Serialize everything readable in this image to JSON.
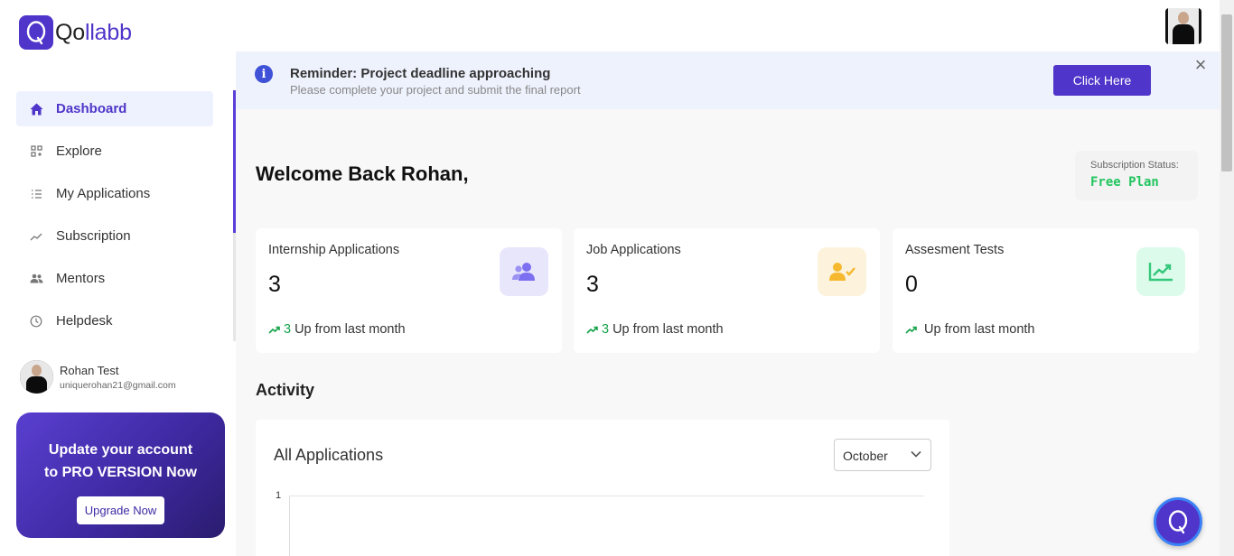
{
  "app": {
    "logo_q": "Q",
    "logo_text_dark": "o",
    "logo_text_brand": "llabb"
  },
  "sidebar": {
    "items": [
      {
        "label": "Dashboard",
        "icon": "home-icon",
        "active": true
      },
      {
        "label": "Explore",
        "icon": "grid-icon",
        "active": false
      },
      {
        "label": "My Applications",
        "icon": "list-icon",
        "active": false
      },
      {
        "label": "Subscription",
        "icon": "trend-icon",
        "active": false
      },
      {
        "label": "Mentors",
        "icon": "people-icon",
        "active": false
      },
      {
        "label": "Helpdesk",
        "icon": "clock-icon",
        "active": false
      }
    ],
    "user": {
      "name": "Rohan Test",
      "email": "uniquerohan21@gmail.com"
    },
    "promo": {
      "line1": "Update your account",
      "line2": "to PRO VERSION Now",
      "button": "Upgrade Now"
    }
  },
  "banner": {
    "icon": "info-icon",
    "title": "Reminder: Project deadline approaching",
    "subtitle": "Please complete your project and submit the final report",
    "button": "Click Here",
    "close": "×"
  },
  "welcome": "Welcome Back Rohan,",
  "subscription": {
    "label": "Subscription Status:",
    "value": "Free Plan"
  },
  "cards": [
    {
      "title": "Internship Applications",
      "value": "3",
      "delta": "3",
      "foot": "Up from last month",
      "icon": "users-icon",
      "icon_bg": "#e8e6fb",
      "icon_color": "#7c6ff0"
    },
    {
      "title": "Job Applications",
      "value": "3",
      "delta": "3",
      "foot": "Up from last month",
      "icon": "user-check-icon",
      "icon_bg": "#fdf3dc",
      "icon_color": "#f5b82e"
    },
    {
      "title": "Assesment Tests",
      "value": "0",
      "delta": "",
      "foot": "Up from last month",
      "icon": "chart-up-icon",
      "icon_bg": "#dcfbea",
      "icon_color": "#34c77b"
    }
  ],
  "activity": {
    "heading": "Activity",
    "chart_title": "All Applications",
    "month": "October",
    "y_tick": "1"
  },
  "chart_data": {
    "type": "line",
    "title": "All Applications",
    "y_ticks": [
      "1"
    ],
    "series": []
  }
}
